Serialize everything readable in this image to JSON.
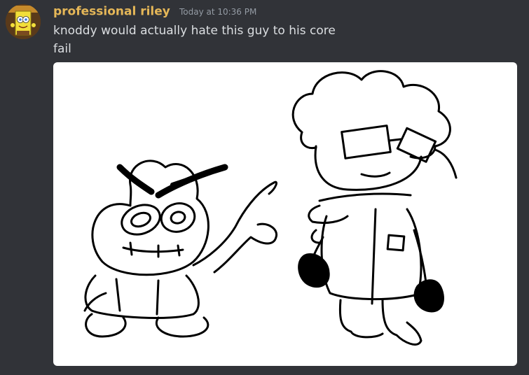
{
  "message": {
    "username": "professional riley",
    "timestamp": "Today at 10:36 PM",
    "lines": [
      "knoddy would actually hate this guy to his core",
      "fail"
    ]
  },
  "avatar": {
    "icon": "spongebob-avatar-icon"
  },
  "attachment": {
    "type": "image",
    "subject": "drawing-icon"
  },
  "colors": {
    "background": "#313338",
    "username": "#e5b758",
    "text": "#dbdee1",
    "timestamp": "#949ba4"
  }
}
